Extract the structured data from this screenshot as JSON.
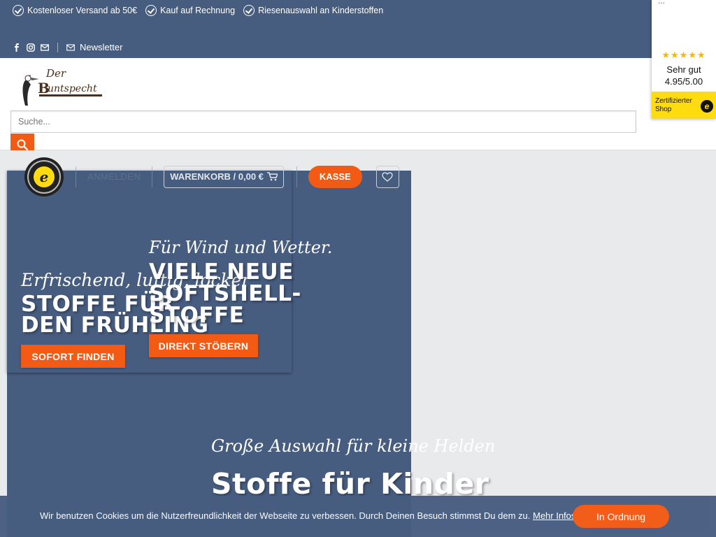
{
  "topbar": {
    "usps": [
      "Kostenloser Versand ab 50€",
      "Kauf auf Rechnung",
      "Riesenauswahl an Kinderstoffen"
    ],
    "newsletter": "Newsletter"
  },
  "header": {
    "logo_text": "Der Buntspecht",
    "search_placeholder": "Suche..."
  },
  "trust_widget": {
    "dots": "...",
    "stars": "★★★★★",
    "rating_label": "Sehr gut",
    "rating_value": "4.95/5.00",
    "badge_text": "Zertifizierter Shop",
    "badge_icon": "e"
  },
  "nav": {
    "login": "ANMELDEN",
    "cart": "WARENKORB / 0,00 €",
    "checkout": "KASSE"
  },
  "slides": [
    {
      "script": "Erfrischend, luftig, locker",
      "title": "STOFFE FÜR DEN FRÜHLING",
      "button": "SOFORT FINDEN"
    },
    {
      "script": "Für Wind und Wetter.",
      "title": "VIELE NEUE SOFTSHELL-STOFFE",
      "button": "DIREKT STÖBERN"
    },
    {
      "script": "Große Auswahl für kleine Helden",
      "title": "Stoffe für Kinder"
    }
  ],
  "cookie": {
    "text": "Wir benutzen Cookies um die Nutzerfreundlichkeit der Webseite zu verbessen. Durch Deinen Besuch stimmst Du dem zu.",
    "link": "Mehr Infos",
    "button": "In Ordnung"
  },
  "colors": {
    "primary": "#475d80",
    "accent": "#f35a14",
    "badge_yellow": "#ffdc0f"
  }
}
